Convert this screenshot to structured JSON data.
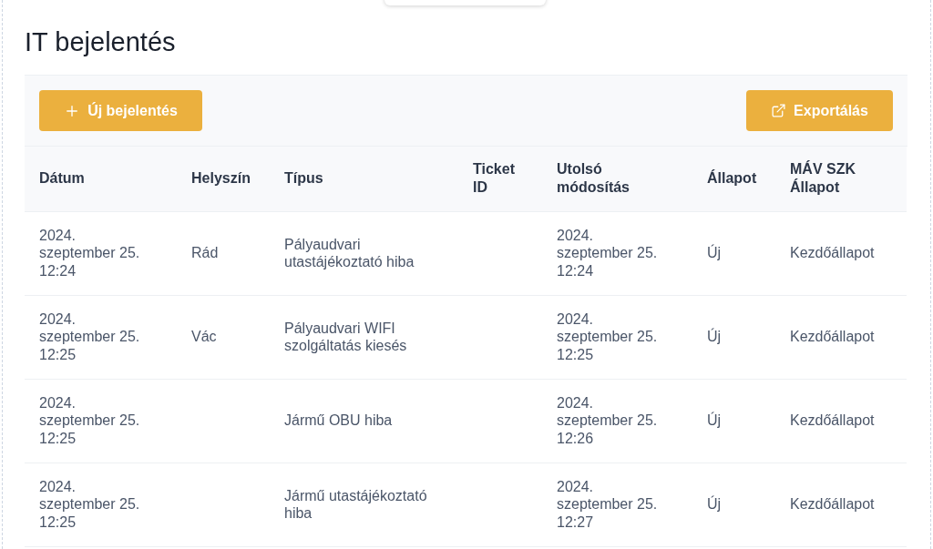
{
  "page": {
    "title": "IT bejelentés"
  },
  "toolbar": {
    "new_button": "Új bejelentés",
    "export_button": "Exportálás"
  },
  "table": {
    "columns": [
      "Dátum",
      "Helyszín",
      "Típus",
      "Ticket ID",
      "Utolsó módosítás",
      "Állapot",
      "MÁV SZK Állapot"
    ],
    "rows": [
      {
        "datum": "2024. szeptember 25. 12:24",
        "helyszin": "Rád",
        "tipus": "Pályaudvari utastájékoztató hiba",
        "utolso_modositas": "2024. szeptember 25. 12:24",
        "allapot": "Új",
        "mav_szk_allapot": "Kezdőállapot"
      },
      {
        "datum": "2024. szeptember 25. 12:25",
        "helyszin": "Vác",
        "tipus": "Pályaudvari WIFI szolgáltatás kiesés",
        "utolso_modositas": "2024. szeptember 25. 12:25",
        "allapot": "Új",
        "mav_szk_allapot": "Kezdőállapot"
      },
      {
        "datum": "2024. szeptember 25. 12:25",
        "tipus": "Jármű OBU hiba",
        "utolso_modositas": "2024. szeptember 25. 12:26",
        "allapot": "Új",
        "mav_szk_allapot": "Kezdőállapot"
      },
      {
        "datum": "2024. szeptember 25. 12:25",
        "tipus": "Jármű utastájékoztató hiba",
        "utolso_modositas": "2024. szeptember 25. 12:27",
        "allapot": "Új",
        "mav_szk_allapot": "Kezdőállapot"
      }
    ]
  }
}
